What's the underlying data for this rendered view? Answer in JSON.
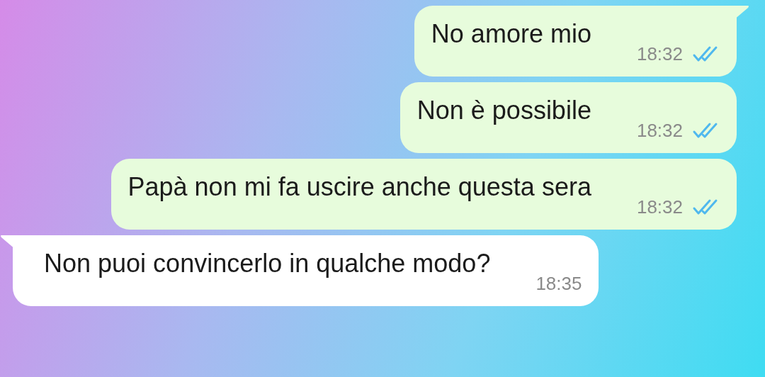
{
  "messages": [
    {
      "kind": "outgoing",
      "text": "No amore mio",
      "time": "18:32",
      "read": true
    },
    {
      "kind": "outgoing",
      "text": "Non è possibile",
      "time": "18:32",
      "read": true
    },
    {
      "kind": "outgoing",
      "text": "Papà non mi fa uscire anche questa sera",
      "time": "18:32",
      "read": true
    },
    {
      "kind": "incoming",
      "text": "Non puoi convincerlo in qualche modo?",
      "time": "18:35"
    }
  ]
}
